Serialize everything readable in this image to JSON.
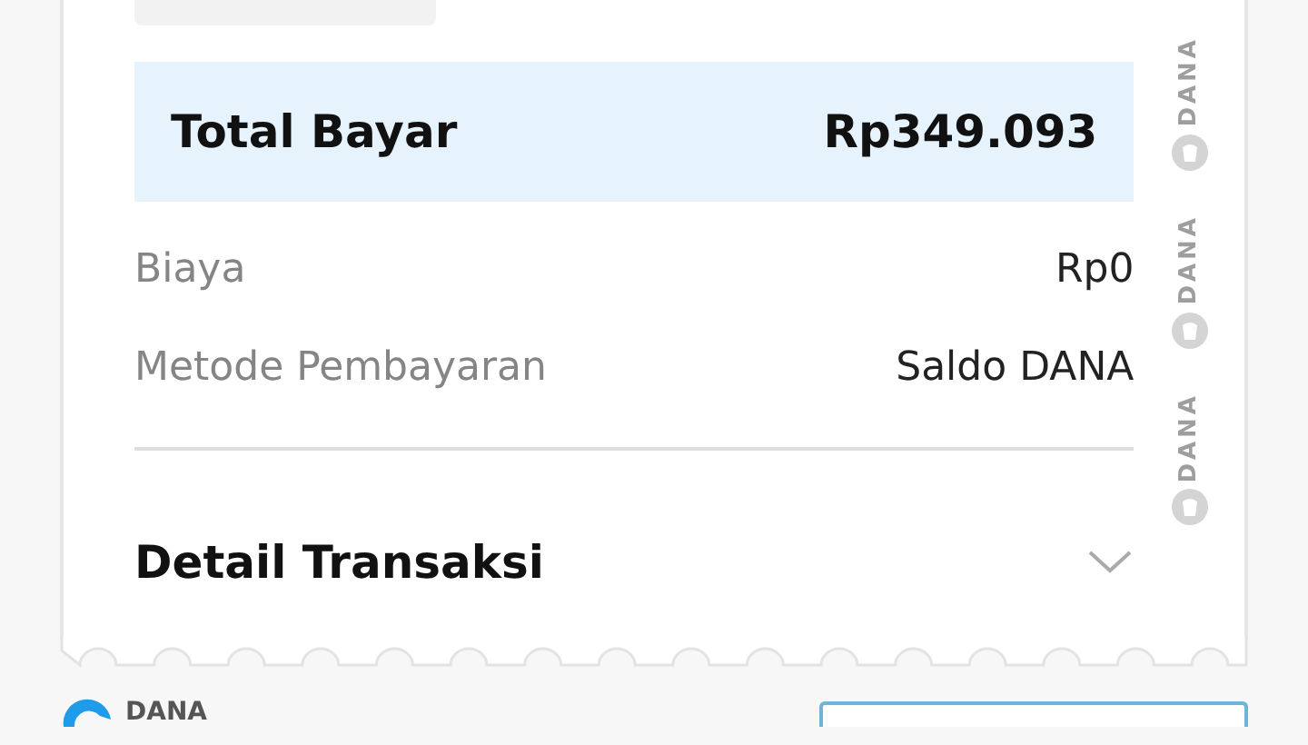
{
  "total": {
    "label": "Total Bayar",
    "value": "Rp349.093"
  },
  "details": [
    {
      "label": "Biaya",
      "value": "Rp0"
    },
    {
      "label": "Metode Pembayaran",
      "value": "Saldo DANA"
    }
  ],
  "section": {
    "title": "Detail Transaksi",
    "expanded": false
  },
  "watermark": [
    "DANA",
    "DANA",
    "DANA"
  ],
  "footer": {
    "brand": "DANA"
  }
}
